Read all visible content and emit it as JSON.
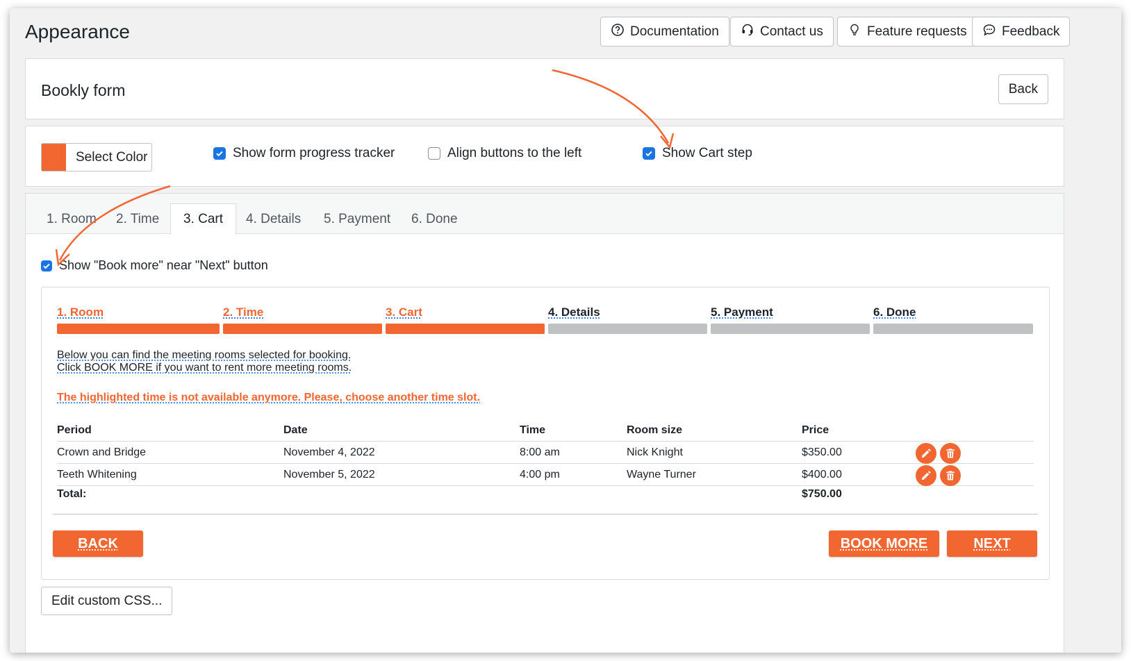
{
  "header": {
    "title": "Appearance",
    "buttons": [
      {
        "label": "Documentation",
        "icon": "question-circle-icon"
      },
      {
        "label": "Contact us",
        "icon": "headset-icon"
      },
      {
        "label": "Feature requests",
        "icon": "lightbulb-icon"
      },
      {
        "label": "Feedback",
        "icon": "chat-icon"
      }
    ]
  },
  "form_section": {
    "title": "Bookly form",
    "back_label": "Back"
  },
  "options": {
    "select_color_label": "Select Color",
    "selected_color": "#f26631",
    "show_progress_tracker": {
      "label": "Show form progress tracker",
      "checked": true
    },
    "align_buttons_left": {
      "label": "Align buttons to the left",
      "checked": false
    },
    "show_cart_step": {
      "label": "Show Cart step",
      "checked": true
    }
  },
  "tabs": [
    {
      "label": "1. Room",
      "active": false
    },
    {
      "label": "2. Time",
      "active": false
    },
    {
      "label": "3. Cart",
      "active": true
    },
    {
      "label": "4. Details",
      "active": false
    },
    {
      "label": "5. Payment",
      "active": false
    },
    {
      "label": "6. Done",
      "active": false
    }
  ],
  "cart_tab": {
    "book_more_option": {
      "label": "Show \"Book more\" near \"Next\" button",
      "checked": true
    }
  },
  "preview": {
    "steps": [
      {
        "label": "1. Room",
        "done": true
      },
      {
        "label": "2. Time",
        "done": true
      },
      {
        "label": "3. Cart",
        "done": true
      },
      {
        "label": "4. Details",
        "done": false
      },
      {
        "label": "5. Payment",
        "done": false
      },
      {
        "label": "6. Done",
        "done": false
      }
    ],
    "info_line_1": "Below you can find the meeting rooms selected for booking.",
    "info_line_2": "Click BOOK MORE if you want to rent more meeting rooms.",
    "warning": "The highlighted time is not available anymore. Please, choose another time slot.",
    "table": {
      "headers": [
        "Period",
        "Date",
        "Time",
        "Room size",
        "Price"
      ],
      "rows": [
        {
          "period": "Crown and Bridge",
          "date": "November 4, 2022",
          "time": "8:00 am",
          "room_size": "Nick Knight",
          "price": "$350.00"
        },
        {
          "period": "Teeth Whitening",
          "date": "November 5, 2022",
          "time": "4:00 pm",
          "room_size": "Wayne Turner",
          "price": "$400.00"
        }
      ],
      "total_label": "Total:",
      "total_value": "$750.00"
    },
    "back_button": "BACK",
    "book_more_button": "BOOK MORE",
    "next_button": "NEXT"
  },
  "edit_css_label": "Edit custom CSS...",
  "colors": {
    "accent": "#f26631",
    "checkbox": "#1b74e4",
    "progress_inactive": "#bfc1c3"
  }
}
